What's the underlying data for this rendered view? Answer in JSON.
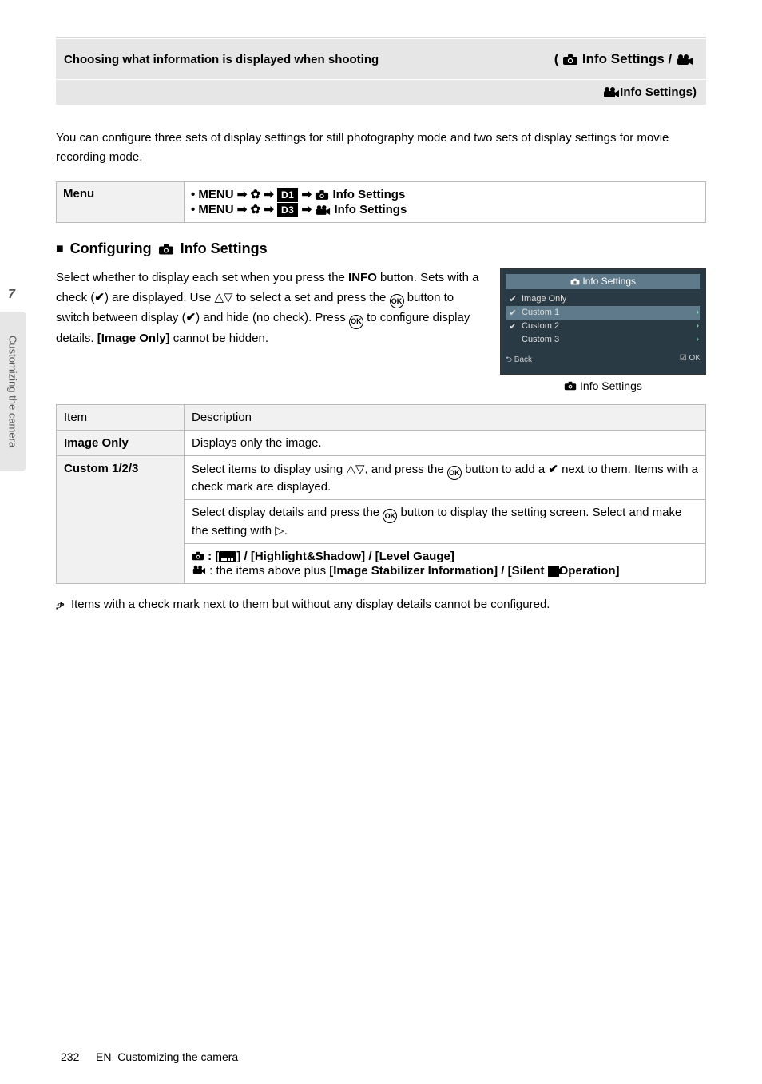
{
  "pageNumber": "232",
  "footer": "Customizing the camera",
  "sideTab": {
    "num": "7",
    "label": "Customizing the camera"
  },
  "titleBar": {
    "left": "Choosing what information is displayed when shooting",
    "rightPrefixCam": "",
    "rightLabel1": "Info Settings /",
    "rightLabel2": "Info Settings)",
    "open": "(",
    "iconCam": "camera",
    "iconMovie": "movie"
  },
  "intro": "You can configure three sets of display settings for still photography mode and two sets of display settings for movie recording mode.",
  "menuTableLabel": "Menu",
  "menuLine1a": "• MENU ",
  "menuLine1b": " ",
  "menuLine1c": " ",
  "menuLine1d": "Info Settings",
  "tabD1": "D1",
  "menuLine2a": "• MENU ",
  "menuLine2d": "Info Settings",
  "tabD3": "D3",
  "sectionTitle": "Configuring",
  "sectionTitleSuffix": "Info Settings",
  "configPara1a": "Select whether to display each set when you press the ",
  "configPara1b": "INFO",
  "configPara1c": " button. Sets with a check (",
  "configPara1d": ") are displayed. Use ",
  "configUpDown": "△▽",
  "configPara1e": " to select a set and press the ",
  "configOK": "OK",
  "configPara1f": " button to switch between display (",
  "configPara1g": ") and hide (no check). Press ",
  "configTriR": "▷",
  "configPara1h": " to configure display details. ",
  "configPara1i": "[Image Only]",
  "configPara1j": " cannot be hidden.",
  "mini": {
    "title": "Info Settings",
    "rows": [
      {
        "check": "✔",
        "label": "Image Only",
        "chev": ""
      },
      {
        "check": "✔",
        "active": true,
        "label": "Custom 1",
        "chev": "›"
      },
      {
        "check": "✔",
        "label": "Custom 2",
        "chev": "›"
      },
      {
        "check": "",
        "label": "Custom 3",
        "chev": "›"
      }
    ],
    "footerL": "Back",
    "footerR": "OK",
    "caption": "Info Settings"
  },
  "dispTable": {
    "h1": "Item",
    "h2": "Description",
    "r1Label": "Image Only",
    "r1Desc": "Displays only the image.",
    "r2Label": "Custom 1/2/3",
    "r2Prefix": "Select items to display using ",
    "r2UpDown": "△▽",
    "r2Mid": ", and press the ",
    "r2OK": "OK",
    "r2End1": " button to add a ",
    "r2End2": " next to them. Items with a check mark are displayed.",
    "r3Prefix": "Select display details and press the ",
    "r3OK": "OK",
    "r3Mid": " button to display the setting screen. Select and make the setting with ",
    "r3Tri": "▷",
    "r3End": ".",
    "camItems": ":[",
    "itemsList": "] / [Highlight&Shadow] / [Level Gauge]",
    "movItemsPrefix": ": the items above plus ",
    "movExtra1": "[Image Stabilizer Information] / [Silent ",
    "movExtra2": "Operation]"
  },
  "bullet": "Items with a check mark next to them but without any display details cannot be configured."
}
